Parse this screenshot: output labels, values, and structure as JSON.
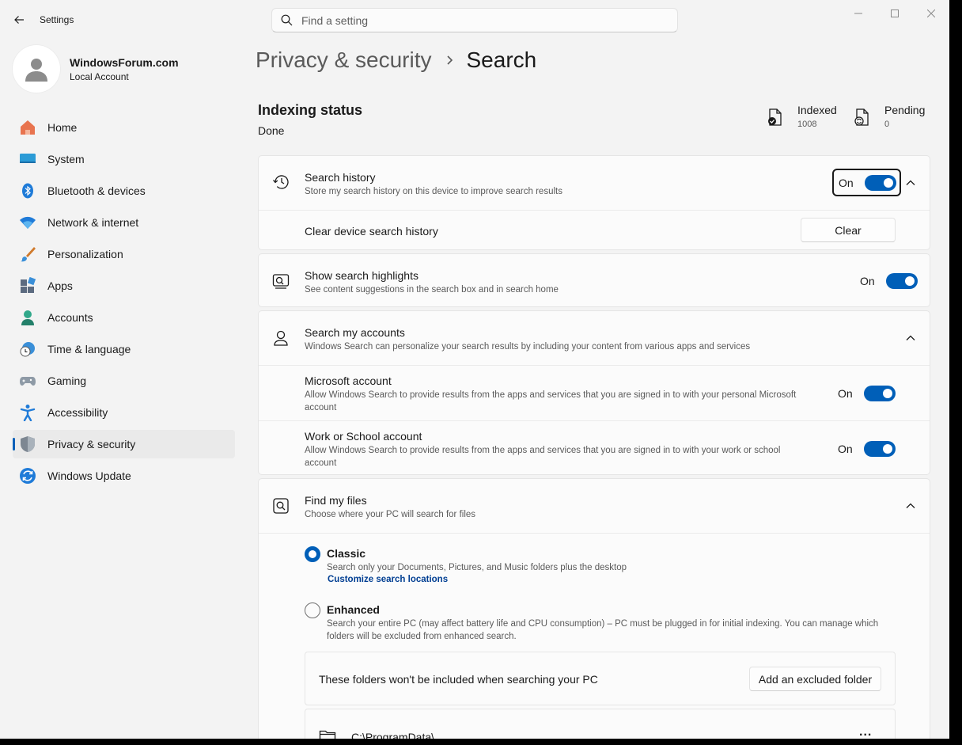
{
  "window": {
    "title": "Settings",
    "search_placeholder": "Find a setting"
  },
  "profile": {
    "name": "WindowsForum.com",
    "account_type": "Local Account"
  },
  "nav": {
    "items": [
      {
        "label": "Home",
        "icon": "home-icon"
      },
      {
        "label": "System",
        "icon": "system-icon"
      },
      {
        "label": "Bluetooth & devices",
        "icon": "bluetooth-icon"
      },
      {
        "label": "Network & internet",
        "icon": "wifi-icon"
      },
      {
        "label": "Personalization",
        "icon": "brush-icon"
      },
      {
        "label": "Apps",
        "icon": "apps-icon"
      },
      {
        "label": "Accounts",
        "icon": "accounts-icon"
      },
      {
        "label": "Time & language",
        "icon": "globe-clock-icon"
      },
      {
        "label": "Gaming",
        "icon": "gamepad-icon"
      },
      {
        "label": "Accessibility",
        "icon": "accessibility-icon"
      },
      {
        "label": "Privacy & security",
        "icon": "shield-icon",
        "active": true
      },
      {
        "label": "Windows Update",
        "icon": "update-icon"
      }
    ]
  },
  "breadcrumb": {
    "parent": "Privacy & security",
    "current": "Search"
  },
  "indexing": {
    "title": "Indexing status",
    "state": "Done",
    "indexed_label": "Indexed",
    "indexed_value": "1008",
    "pending_label": "Pending",
    "pending_value": "0"
  },
  "search_history": {
    "title": "Search history",
    "description": "Store my search history on this device to improve search results",
    "toggle_state": "On",
    "clear_label": "Clear device search history",
    "clear_button": "Clear"
  },
  "search_highlights": {
    "title": "Show search highlights",
    "description": "See content suggestions in the search box and in search home",
    "toggle_state": "On"
  },
  "search_accounts": {
    "title": "Search my accounts",
    "description": "Windows Search can personalize your search results by including your content from various apps and services",
    "microsoft": {
      "title": "Microsoft account",
      "description": "Allow Windows Search to provide results from the apps and services that you are signed in to with your personal Microsoft account",
      "toggle_state": "On"
    },
    "work": {
      "title": "Work or School account",
      "description": "Allow Windows Search to provide results from the apps and services that you are signed in to with your work or school account",
      "toggle_state": "On"
    }
  },
  "find_files": {
    "title": "Find my files",
    "description": "Choose where your PC will search for files",
    "classic": {
      "title": "Classic",
      "description": "Search only your Documents, Pictures, and Music folders plus the desktop",
      "link": "Customize search locations",
      "selected": true
    },
    "enhanced": {
      "title": "Enhanced",
      "description": "Search your entire PC (may affect battery life and CPU consumption) – PC must be plugged in for initial indexing. You can manage which folders will be excluded from enhanced search.",
      "selected": false
    },
    "excluded_label": "These folders won't be included when searching your PC",
    "add_excluded_button": "Add an excluded folder",
    "excluded_folders": [
      "C:\\ProgramData\\"
    ],
    "more_label": "..."
  },
  "colors": {
    "accent": "#005fb8",
    "window_bg": "#f3f3f3",
    "card_bg": "#fbfbfb"
  }
}
